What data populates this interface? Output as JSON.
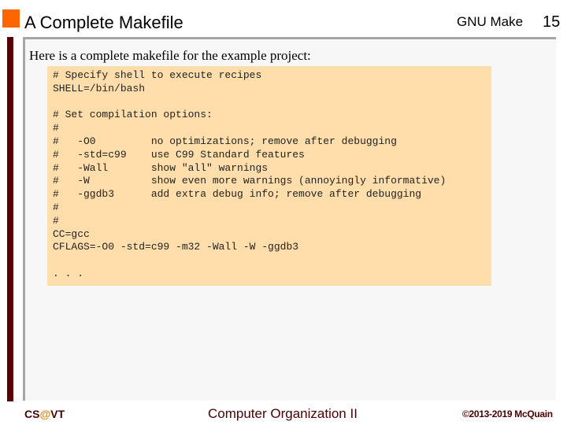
{
  "header": {
    "title": "A Complete Makefile",
    "topic": "GNU Make",
    "slide_number": "15",
    "accent_color": "#ff6600"
  },
  "content": {
    "intro": "Here is a complete makefile for the example project:",
    "code_lines": [
      "# Specify shell to execute recipes",
      "SHELL=/bin/bash",
      "",
      "# Set compilation options:",
      "#",
      "#   -O0         no optimizations; remove after debugging",
      "#   -std=c99    use C99 Standard features",
      "#   -Wall       show \"all\" warnings",
      "#   -W          show even more warnings (annoyingly informative)",
      "#   -ggdb3      add extra debug info; remove after debugging",
      "#",
      "#",
      "CC=gcc",
      "CFLAGS=-O0 -std=c99 -m32 -Wall -W -ggdb3",
      "",
      ". . ."
    ]
  },
  "footer": {
    "left_prefix": "CS",
    "left_at": "@",
    "left_suffix": "VT",
    "center": "Computer Organization II",
    "right": "©2013-2019 McQuain"
  }
}
